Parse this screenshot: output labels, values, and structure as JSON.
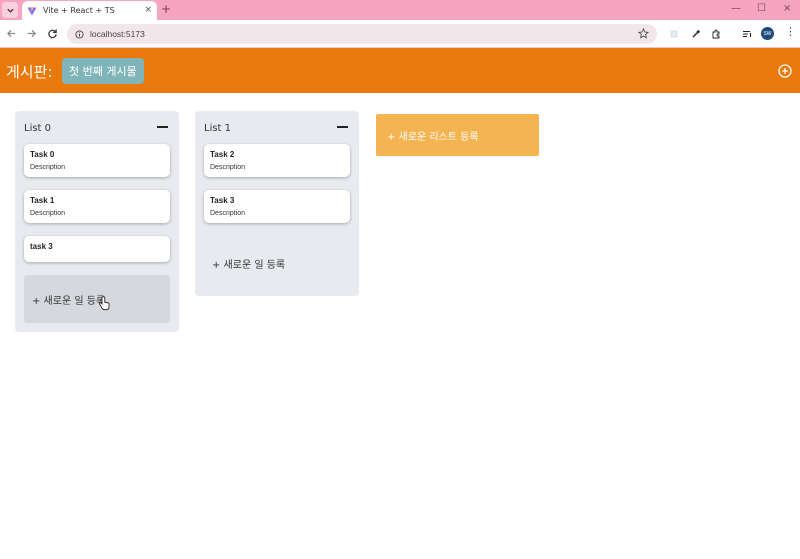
{
  "browser": {
    "tab_title": "Vite + React + TS",
    "tab_close": "×",
    "new_tab": "+",
    "url": "localhost:5173",
    "win_minimize": "—",
    "win_maximize": "☐",
    "win_close": "×",
    "profile_initials": "SW",
    "menu": "⋮"
  },
  "header": {
    "board_label": "게시판:",
    "board_name": "첫 번째 게시물"
  },
  "lists": [
    {
      "title": "List 0",
      "tasks": [
        {
          "title": "Task 0",
          "description": "Description"
        },
        {
          "title": "Task 1",
          "description": "Description"
        },
        {
          "title": "task 3",
          "description": ""
        }
      ],
      "add_task_label": "+ 새로운 일 등록"
    },
    {
      "title": "List 1",
      "tasks": [
        {
          "title": "Task 2",
          "description": "Description"
        },
        {
          "title": "Task 3",
          "description": "Description"
        }
      ],
      "add_task_label": "+ 새로운 일 등록"
    }
  ],
  "add_list_label": "+ 새로운 리스트 등록",
  "colors": {
    "header": "#e8790a",
    "board_chip": "#7fb5b8",
    "list_bg": "#e8eaef",
    "add_list": "#f4b452",
    "tab_strip": "#f6a5c0"
  }
}
